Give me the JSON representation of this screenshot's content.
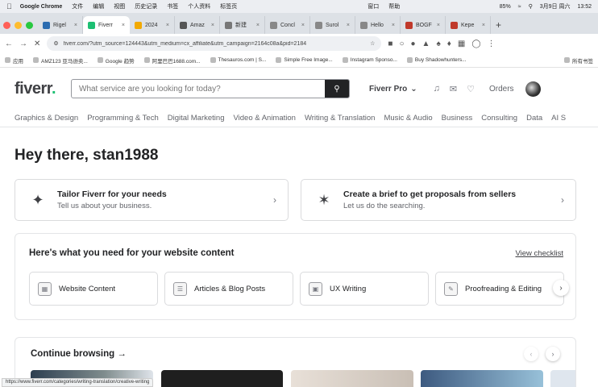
{
  "menubar": {
    "app": "Google Chrome",
    "items": [
      "文件",
      "编辑",
      "视图",
      "历史记录",
      "书签",
      "个人资料",
      "标签页"
    ],
    "right_items": [
      "窗口",
      "帮助"
    ],
    "battery": "85%",
    "date": "3月9日 周六",
    "time": "13:52"
  },
  "tabs": [
    {
      "label": "Rigel",
      "fav_color": "#2b6cb0",
      "active": false
    },
    {
      "label": "Fiverr",
      "fav_color": "#1dbf73",
      "active": true
    },
    {
      "label": "2024",
      "fav_color": "#f2a900",
      "active": false
    },
    {
      "label": "Amaz",
      "fav_color": "#555555",
      "active": false
    },
    {
      "label": "新建",
      "fav_color": "#777777",
      "active": false
    },
    {
      "label": "Concl",
      "fav_color": "#888888",
      "active": false
    },
    {
      "label": "Surol",
      "fav_color": "#888888",
      "active": false
    },
    {
      "label": "Hello",
      "fav_color": "#888888",
      "active": false
    },
    {
      "label": "BOGF",
      "fav_color": "#c0392b",
      "active": false
    },
    {
      "label": "Kepe",
      "fav_color": "#c0392b",
      "active": false
    }
  ],
  "toolbar": {
    "url": "fiverr.com/?utm_source=124443&utm_medium=cx_affiliate&utm_campaign=2164c08a&pid=2184"
  },
  "bookmarks": {
    "items": [
      "应用",
      "AMZ123 亚马逊卖...",
      "Google 趋势",
      "阿里巴巴1688.com...",
      "Thesauros.com | S...",
      "Simple Free Image...",
      "Instagram Sponso...",
      "Buy Shadowhunters..."
    ],
    "all_label": "所有书签"
  },
  "header": {
    "logo_text": "fiverr",
    "logo_dot": ".",
    "search_placeholder": "What service are you looking for today?",
    "pro_label": "Fiverr Pro",
    "orders_label": "Orders"
  },
  "categories": [
    "Graphics & Design",
    "Programming & Tech",
    "Digital Marketing",
    "Video & Animation",
    "Writing & Translation",
    "Music & Audio",
    "Business",
    "Consulting",
    "Data",
    "AI S"
  ],
  "greeting": "Hey there, stan1988",
  "action_cards": [
    {
      "title": "Tailor Fiverr for your needs",
      "subtitle": "Tell us about your business."
    },
    {
      "title": "Create a brief to get proposals from sellers",
      "subtitle": "Let us do the searching."
    }
  ],
  "website_panel": {
    "title": "Here's what you need for your website content",
    "link": "View checklist",
    "chips": [
      "Website Content",
      "Articles & Blog Posts",
      "UX Writing",
      "Proofreading & Editing"
    ]
  },
  "continue_browsing": {
    "title": "Continue browsing →"
  },
  "status_text": "https://www.fiverr.com/categories/writing-translation/creative-writing",
  "colors": {
    "brand_green": "#1dbf73",
    "search_button": "#222325"
  }
}
